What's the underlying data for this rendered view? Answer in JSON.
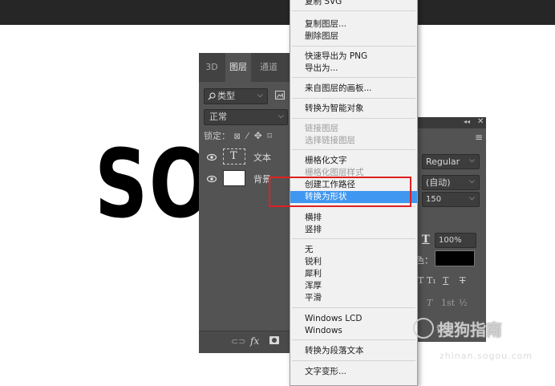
{
  "canvas": {
    "text": "SO"
  },
  "layers_panel": {
    "tabs": [
      {
        "label": "3D",
        "active": false
      },
      {
        "label": "图层",
        "active": true
      },
      {
        "label": "通道",
        "active": false
      }
    ],
    "filter_label": "类型",
    "blend_mode": "正常",
    "lock_label": "锁定：",
    "layers": [
      {
        "name": "文本",
        "thumb": "T",
        "type": "text"
      },
      {
        "name": "背景",
        "type": "image"
      }
    ],
    "footer_fx": "fx"
  },
  "character_panel": {
    "font_style": "Regular",
    "leading": "(自动)",
    "tracking": "150",
    "vertical_scale": "100%",
    "color_label": "色：",
    "color_value": "#000000",
    "style_buttons": [
      "T",
      "T₁",
      "T",
      "T"
    ],
    "opentype_buttons": [
      "T",
      "1st",
      "½"
    ],
    "anti_alias_partial": "锐利"
  },
  "context_menu": {
    "items": [
      {
        "label": "复制 SVG",
        "state": "normal"
      },
      {
        "label": "复制图层...",
        "state": "normal"
      },
      {
        "label": "删除图层",
        "state": "normal"
      },
      {
        "label": "快速导出为 PNG",
        "state": "normal"
      },
      {
        "label": "导出为...",
        "state": "normal"
      },
      {
        "label": "来自图层的画板...",
        "state": "normal"
      },
      {
        "label": "转换为智能对象",
        "state": "normal"
      },
      {
        "label": "链接图层",
        "state": "disabled"
      },
      {
        "label": "选择链接图层",
        "state": "disabled"
      },
      {
        "label": "栅格化文字",
        "state": "normal"
      },
      {
        "label": "栅格化图层样式",
        "state": "disabled"
      },
      {
        "label": "创建工作路径",
        "state": "normal"
      },
      {
        "label": "转换为形状",
        "state": "selected"
      },
      {
        "label": "横排",
        "state": "normal"
      },
      {
        "label": "竖排",
        "state": "normal"
      },
      {
        "label": "无",
        "state": "normal"
      },
      {
        "label": "锐利",
        "state": "normal"
      },
      {
        "label": "犀利",
        "state": "normal"
      },
      {
        "label": "浑厚",
        "state": "normal"
      },
      {
        "label": "平滑",
        "state": "normal"
      },
      {
        "label": "Windows LCD",
        "state": "normal"
      },
      {
        "label": "Windows",
        "state": "normal"
      },
      {
        "label": "转换为段落文本",
        "state": "normal"
      },
      {
        "label": "文字变形...",
        "state": "normal"
      }
    ]
  },
  "watermark": {
    "text": "搜狗指南",
    "url": "zhinan.sogou.com"
  },
  "colors": {
    "selection": "#3f97f0",
    "highlight_box": "#e02020",
    "panel_bg": "#535353"
  }
}
